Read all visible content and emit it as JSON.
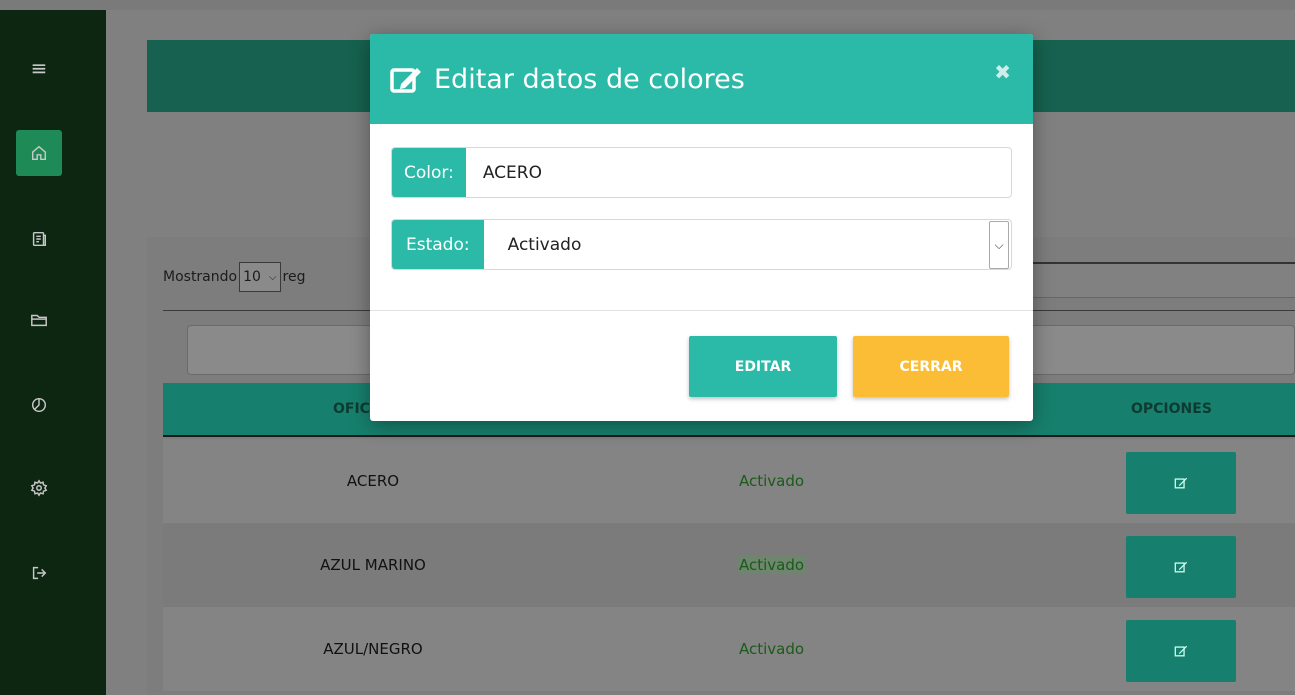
{
  "sidebar": {
    "items": [
      {
        "icon": "menu-icon",
        "glyph": "≡"
      },
      {
        "icon": "home-icon",
        "active": true
      },
      {
        "icon": "document-icon"
      },
      {
        "icon": "folder-icon"
      },
      {
        "icon": "chart-pie-icon"
      },
      {
        "icon": "gear-icon"
      },
      {
        "icon": "logout-icon"
      }
    ]
  },
  "table": {
    "length_prefix": "Mostrando",
    "length_value": "10",
    "length_suffix": "reg",
    "headers": {
      "name": "OFIC",
      "options": "OPCIONES"
    },
    "rows": [
      {
        "name": "ACERO",
        "state": "Activado"
      },
      {
        "name": "AZUL MARINO",
        "state": "Activado"
      },
      {
        "name": "AZUL/NEGRO",
        "state": "Activado"
      }
    ]
  },
  "modal": {
    "title": "Editar datos de colores",
    "close_glyph": "✖",
    "color_label": "Color:",
    "color_value": "ACERO",
    "estado_label": "Estado:",
    "estado_value": "Activado",
    "edit_button": "EDITAR",
    "close_button": "CERRAR"
  },
  "colors": {
    "accent": "#2bbaa8",
    "sidebar": "#0d2612",
    "close_button": "#fbbd36"
  }
}
